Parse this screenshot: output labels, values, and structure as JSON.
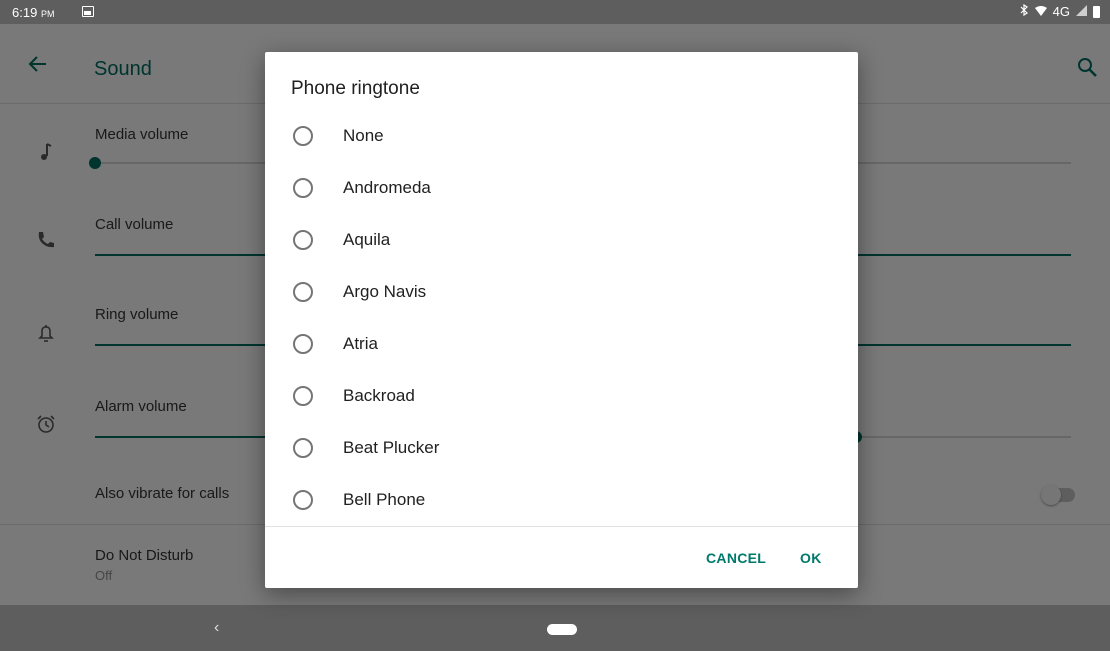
{
  "status_bar": {
    "time": "6:19",
    "ampm": "PM",
    "network": "4G"
  },
  "toolbar": {
    "title": "Sound"
  },
  "settings": {
    "media_volume": {
      "label": "Media volume",
      "level": 0.0
    },
    "call_volume": {
      "label": "Call volume"
    },
    "ring_volume": {
      "label": "Ring volume"
    },
    "alarm_volume": {
      "label": "Alarm volume",
      "level": 0.78
    },
    "vibrate": {
      "label": "Also vibrate for calls",
      "on": false
    },
    "dnd": {
      "label": "Do Not Disturb",
      "value": "Off"
    }
  },
  "dialog": {
    "title": "Phone ringtone",
    "options": [
      {
        "label": "None"
      },
      {
        "label": "Andromeda"
      },
      {
        "label": "Aquila"
      },
      {
        "label": "Argo Navis"
      },
      {
        "label": "Atria"
      },
      {
        "label": "Backroad"
      },
      {
        "label": "Beat Plucker"
      },
      {
        "label": "Bell Phone"
      }
    ],
    "cancel_label": "CANCEL",
    "ok_label": "OK"
  },
  "colors": {
    "accent": "#00695c",
    "button_text": "#00796b"
  },
  "icons": [
    "back-arrow-icon",
    "search-icon",
    "music-note-icon",
    "phone-icon",
    "bell-icon",
    "alarm-clock-icon",
    "bluetooth-icon",
    "wifi-icon",
    "signal-icon",
    "battery-icon",
    "image-notification-icon"
  ]
}
